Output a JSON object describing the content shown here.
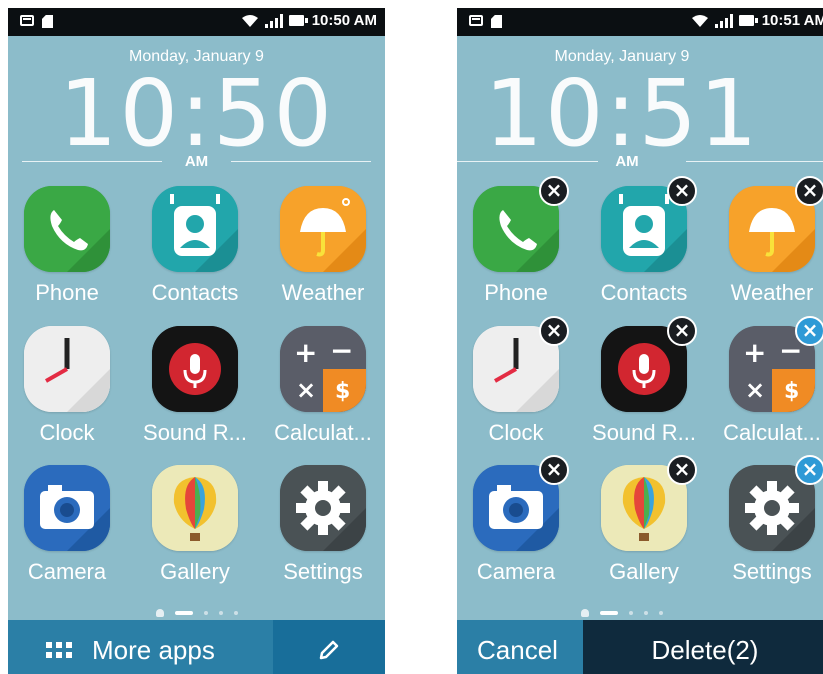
{
  "left": {
    "status_time": "10:50 AM",
    "date": "Monday, January 9",
    "clock": "10:50",
    "ampm": "AM",
    "apps": [
      {
        "label": "Phone",
        "icon": "phone-icon"
      },
      {
        "label": "Contacts",
        "icon": "contacts-icon"
      },
      {
        "label": "Weather",
        "icon": "weather-icon"
      },
      {
        "label": "Clock",
        "icon": "clock-icon"
      },
      {
        "label": "Sound R...",
        "icon": "microphone-icon"
      },
      {
        "label": "Calculat...",
        "icon": "calculator-icon"
      },
      {
        "label": "Camera",
        "icon": "camera-icon"
      },
      {
        "label": "Gallery",
        "icon": "balloon-icon"
      },
      {
        "label": "Settings",
        "icon": "gear-icon"
      }
    ],
    "more_apps_label": "More apps"
  },
  "right": {
    "status_time": "10:51 AM",
    "date": "Monday, January 9",
    "clock": "10:51",
    "ampm": "AM",
    "apps": [
      {
        "label": "Phone",
        "icon": "phone-icon"
      },
      {
        "label": "Contacts",
        "icon": "contacts-icon"
      },
      {
        "label": "Weather",
        "icon": "weather-icon"
      },
      {
        "label": "Clock",
        "icon": "clock-icon"
      },
      {
        "label": "Sound R...",
        "icon": "microphone-icon"
      },
      {
        "label": "Calculat...",
        "icon": "calculator-icon"
      },
      {
        "label": "Camera",
        "icon": "camera-icon"
      },
      {
        "label": "Gallery",
        "icon": "balloon-icon"
      },
      {
        "label": "Settings",
        "icon": "gear-icon"
      }
    ],
    "cancel_label": "Cancel",
    "delete_label": "Delete(2)"
  },
  "colors": {
    "wallpaper": "#8cbcca",
    "bottom_bar": "#2b7fa6",
    "delete_bar": "#0f2a3d",
    "badge_selected": "#2f9ad6"
  }
}
